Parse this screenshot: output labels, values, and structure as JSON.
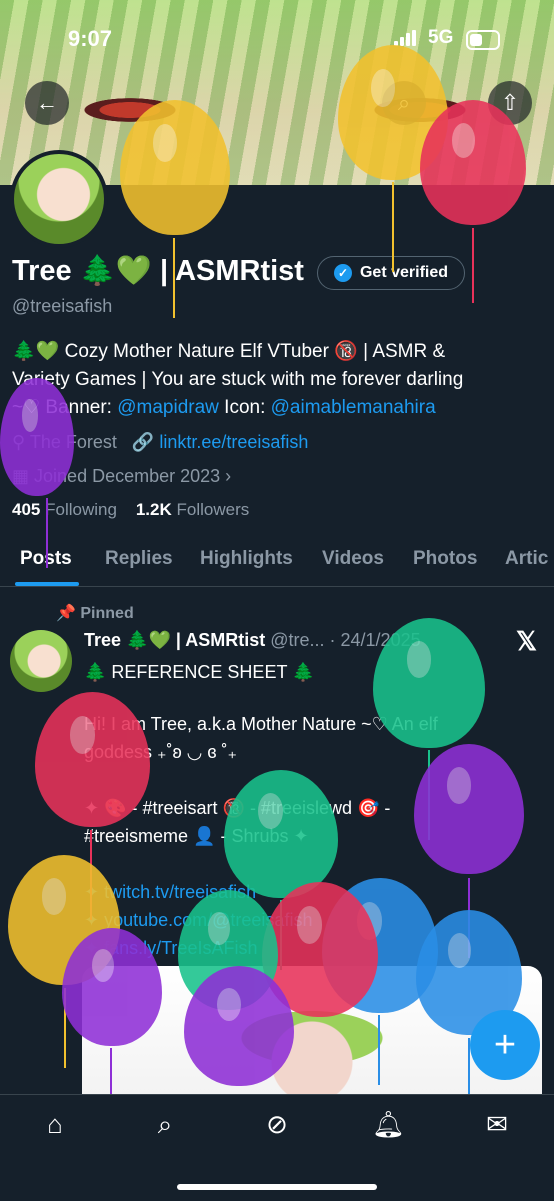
{
  "status": {
    "time": "9:07",
    "network": "5G"
  },
  "profile": {
    "name": "Tree 🌲💚 | ASMRtist",
    "verify_label": "Get verified",
    "handle": "@treeisafish",
    "bio_line1": "🌲💚 Cozy Mother Nature Elf VTuber 🔞 | ASMR &",
    "bio_line2": "Variety Games | You are stuck with me forever darling",
    "bio_line3_prefix": "~♡ Banner: ",
    "banner_credit": "@mapidraw",
    "icon_label": " Icon: ",
    "icon_credit": "@aimablemanahira",
    "location": "The Forest",
    "website": "linktr.ee/treeisafish",
    "joined": "Joined December 2023",
    "following_count": "405",
    "following_label": "Following",
    "followers_count": "1.2K",
    "followers_label": "Followers"
  },
  "tabs": [
    "Posts",
    "Replies",
    "Highlights",
    "Videos",
    "Photos",
    "Artic"
  ],
  "post": {
    "pinned_label": "Pinned",
    "author": "Tree 🌲💚 | ASMRtist",
    "handle_date": "@tre... · 24/1/2025",
    "line1": "🌲 REFERENCE SHEET 🌲",
    "line2": "Hi! I am Tree, a.k.a Mother Nature ~♡ An elf",
    "line3": "goddess ₊˚ʚ ◡ ɞ ˚₊",
    "line4": "✦ 🎨 - #treeisart 🔞 - #treeislewd 🎯 -",
    "line5": "#treeismeme 👤 - Shrubs ✦",
    "line6": "✦ twitch.tv/treeisafish",
    "line7": "✦ youtube.com/@treeisafish",
    "line8": "✦ fans.ly/TreeIsAFish"
  },
  "icons": [
    "back-arrow-icon",
    "search-icon",
    "share-icon",
    "pin-icon",
    "x-logo-icon",
    "home-icon",
    "search-nav-icon",
    "grok-icon",
    "bell-icon",
    "mail-icon",
    "plus-icon"
  ],
  "colors": {
    "accent": "#1d9bf0",
    "background": "#15202b",
    "muted": "#8b98a5"
  }
}
